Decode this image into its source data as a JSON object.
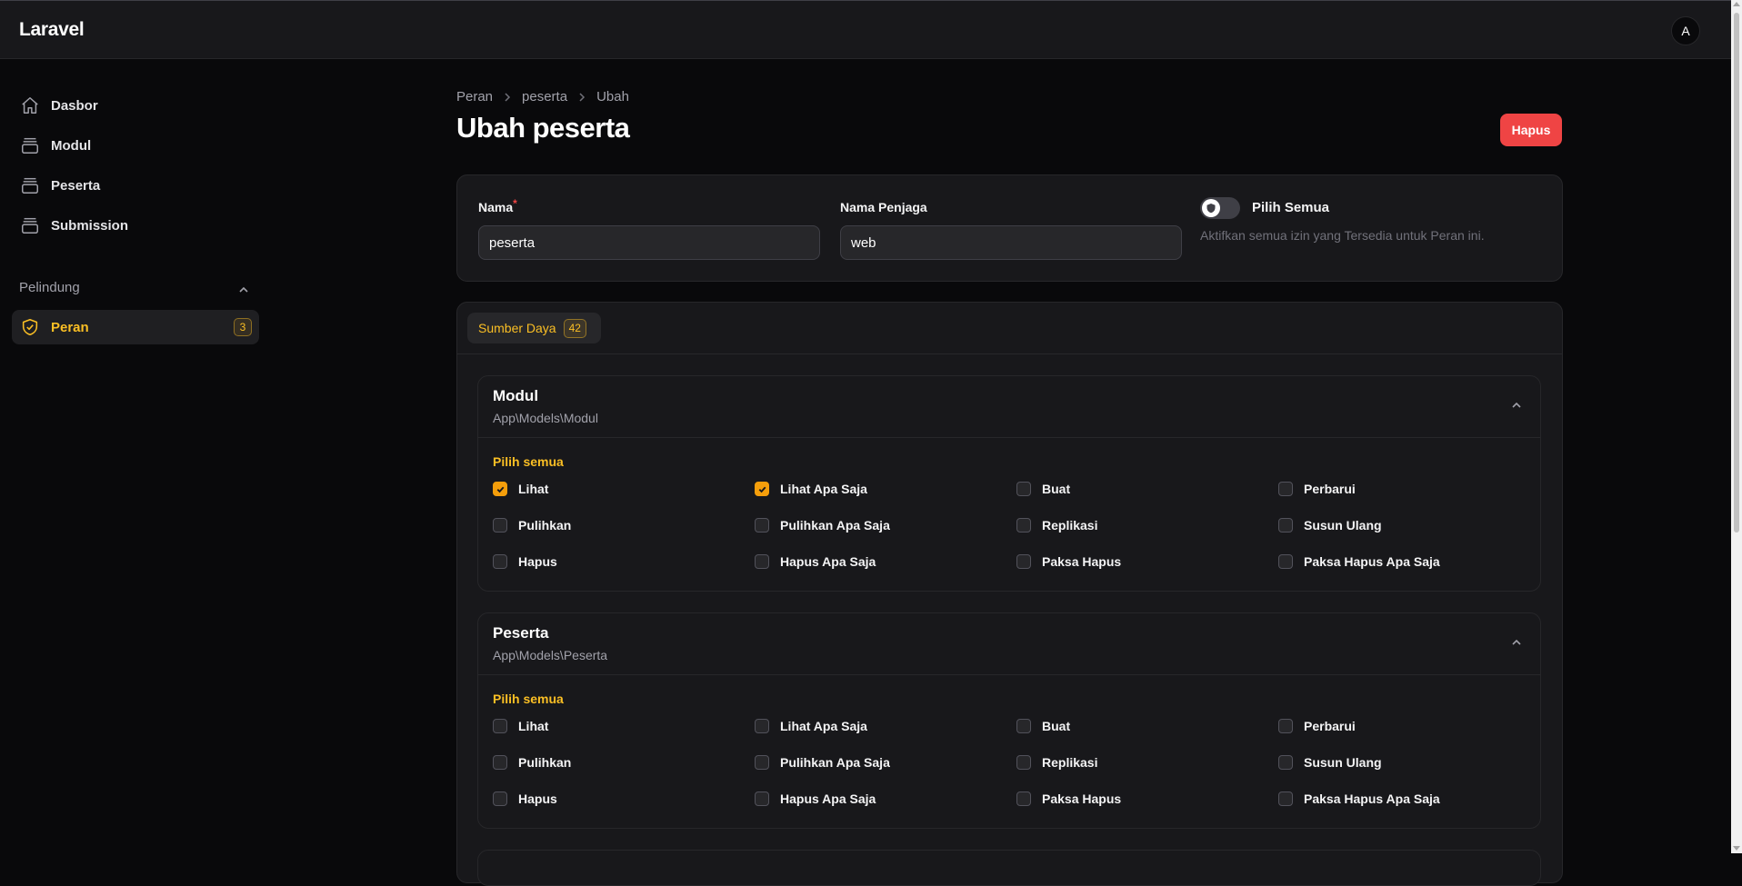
{
  "app": {
    "brand": "Laravel",
    "avatar_initial": "A"
  },
  "sidebar": {
    "items": [
      {
        "label": "Dasbor",
        "icon": "home-icon"
      },
      {
        "label": "Modul",
        "icon": "box-icon"
      },
      {
        "label": "Peserta",
        "icon": "box-icon"
      },
      {
        "label": "Submission",
        "icon": "box-icon"
      }
    ],
    "group": {
      "label": "Pelindung",
      "items": [
        {
          "label": "Peran",
          "icon": "shield-check-icon",
          "badge": "3",
          "active": true
        }
      ]
    }
  },
  "breadcrumb": [
    "Peran",
    "peserta",
    "Ubah"
  ],
  "page": {
    "title": "Ubah peserta",
    "delete_label": "Hapus"
  },
  "form": {
    "name_label": "Nama",
    "name_required_mark": "*",
    "name_value": "peserta",
    "guard_label": "Nama Penjaga",
    "guard_value": "web",
    "toggle_label": "Pilih Semua",
    "toggle_help": "Aktifkan semua izin yang Tersedia untuk Peran ini.",
    "toggle_on": false
  },
  "tabs": [
    {
      "label": "Sumber Daya",
      "badge": "42",
      "active": true
    }
  ],
  "sections": [
    {
      "title": "Modul",
      "subtitle": "App\\Models\\Modul",
      "select_all_label": "Pilih semua",
      "permissions": [
        {
          "label": "Lihat",
          "checked": true
        },
        {
          "label": "Lihat Apa Saja",
          "checked": true
        },
        {
          "label": "Buat",
          "checked": false
        },
        {
          "label": "Perbarui",
          "checked": false
        },
        {
          "label": "Pulihkan",
          "checked": false
        },
        {
          "label": "Pulihkan Apa Saja",
          "checked": false
        },
        {
          "label": "Replikasi",
          "checked": false
        },
        {
          "label": "Susun Ulang",
          "checked": false
        },
        {
          "label": "Hapus",
          "checked": false
        },
        {
          "label": "Hapus Apa Saja",
          "checked": false
        },
        {
          "label": "Paksa Hapus",
          "checked": false
        },
        {
          "label": "Paksa Hapus Apa Saja",
          "checked": false
        }
      ]
    },
    {
      "title": "Peserta",
      "subtitle": "App\\Models\\Peserta",
      "select_all_label": "Pilih semua",
      "permissions": [
        {
          "label": "Lihat",
          "checked": false
        },
        {
          "label": "Lihat Apa Saja",
          "checked": false
        },
        {
          "label": "Buat",
          "checked": false
        },
        {
          "label": "Perbarui",
          "checked": false
        },
        {
          "label": "Pulihkan",
          "checked": false
        },
        {
          "label": "Pulihkan Apa Saja",
          "checked": false
        },
        {
          "label": "Replikasi",
          "checked": false
        },
        {
          "label": "Susun Ulang",
          "checked": false
        },
        {
          "label": "Hapus",
          "checked": false
        },
        {
          "label": "Hapus Apa Saja",
          "checked": false
        },
        {
          "label": "Paksa Hapus",
          "checked": false
        },
        {
          "label": "Paksa Hapus Apa Saja",
          "checked": false
        }
      ]
    }
  ],
  "colors": {
    "accent": "#fbbf24",
    "checkbox_checked": "#f59e0b",
    "danger": "#ef4444",
    "background": "#09090b",
    "surface": "#18181b"
  }
}
